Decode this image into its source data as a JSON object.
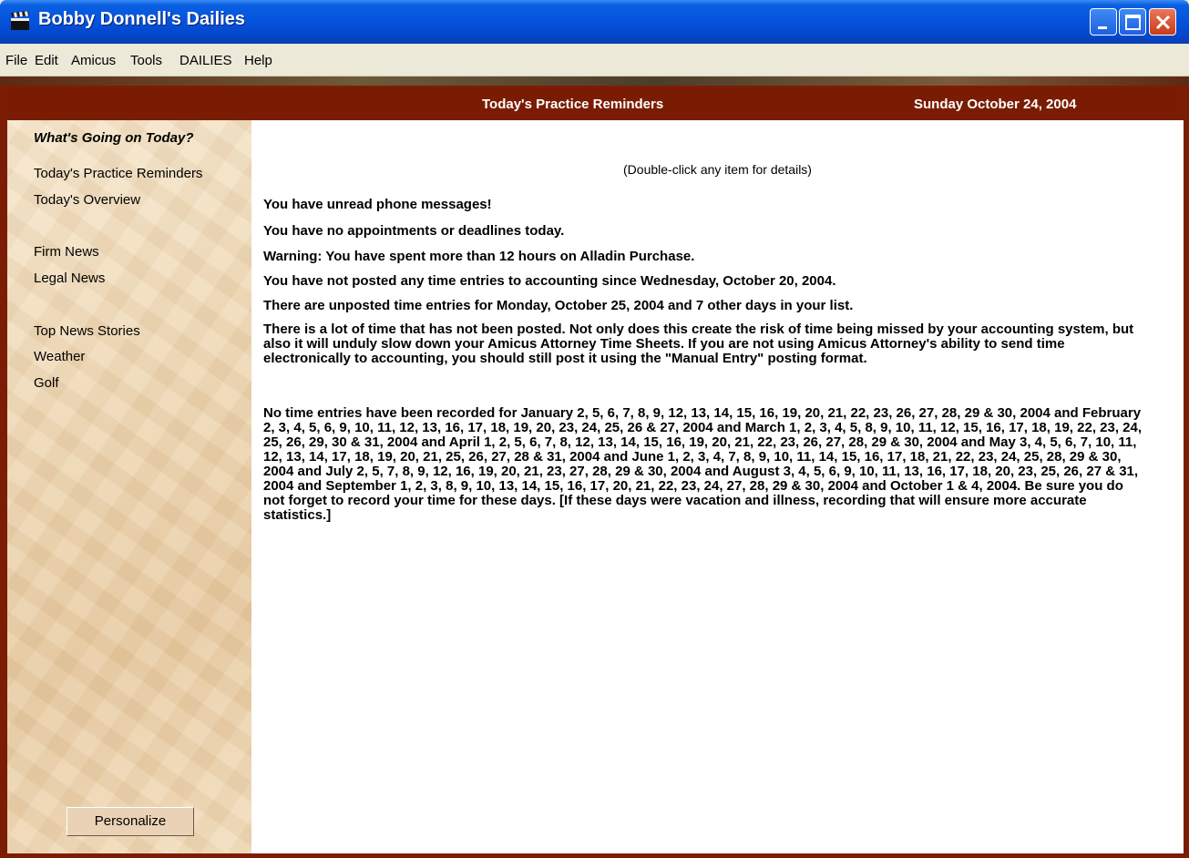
{
  "window": {
    "title": "Bobby Donnell's Dailies",
    "icon": "clapperboard-icon"
  },
  "menu": [
    "File",
    "Edit",
    "Amicus",
    "Tools",
    "DAILIES",
    "Help"
  ],
  "header": {
    "title": "Today's Practice Reminders",
    "date": "Sunday October 24, 2004"
  },
  "sidebar": {
    "heading": "What's Going on Today?",
    "links": [
      "Today's Practice Reminders",
      "Today's Overview",
      "Firm News",
      "Legal News",
      "Top News Stories",
      "Weather",
      "Golf"
    ],
    "personalize_label": "Personalize"
  },
  "main": {
    "hint": "(Double-click any item for details)",
    "messages": [
      "You have unread phone messages!",
      "You have no appointments or deadlines today.",
      "Warning:  You have spent more than 12 hours on Alladin Purchase.",
      "You have not posted any time entries to accounting since Wednesday, October 20, 2004.",
      "There are unposted time entries for Monday, October 25, 2004 and 7 other days in your list.",
      "There is a lot of time that has not been posted.  Not only does this create the risk of time being missed by your accounting system, but also it will unduly slow down your Amicus Attorney Time Sheets. If you are not using Amicus Attorney's ability to send time electronically to accounting, you should still post it using the \"Manual Entry\" posting format.",
      "No time entries have been recorded for January 2, 5, 6, 7, 8, 9, 12, 13, 14, 15, 16, 19, 20, 21, 22, 23, 26, 27, 28, 29 & 30, 2004 and February 2, 3, 4, 5, 6, 9, 10, 11, 12, 13, 16, 17, 18, 19, 20, 23, 24, 25, 26 & 27, 2004 and March 1, 2, 3, 4, 5, 8, 9, 10, 11, 12, 15, 16, 17, 18, 19, 22, 23, 24, 25, 26, 29, 30 & 31, 2004 and April 1, 2, 5, 6, 7, 8, 12, 13, 14, 15, 16, 19, 20, 21, 22, 23, 26, 27, 28, 29 & 30, 2004 and May 3, 4, 5, 6, 7, 10, 11, 12, 13, 14, 17, 18, 19, 20, 21, 25, 26, 27, 28 & 31, 2004 and June 1, 2, 3, 4, 7, 8, 9, 10, 11, 14, 15, 16, 17, 18, 21, 22, 23, 24, 25, 28, 29 & 30, 2004 and July 2, 5, 7, 8, 9, 12, 16, 19, 20, 21, 23, 27, 28, 29 & 30, 2004 and August 3, 4, 5, 6, 9, 10, 11, 13, 16, 17, 18, 20, 23, 25, 26, 27 & 31, 2004 and September 1, 2, 3, 8, 9, 10, 13, 14, 15, 16, 17, 20, 21, 22, 23, 24, 27, 28, 29 & 30, 2004 and October 1 & 4, 2004. Be sure you do not forget to record your time for these days. [If these days were vacation and illness, recording that will ensure more accurate statistics.]"
    ]
  }
}
